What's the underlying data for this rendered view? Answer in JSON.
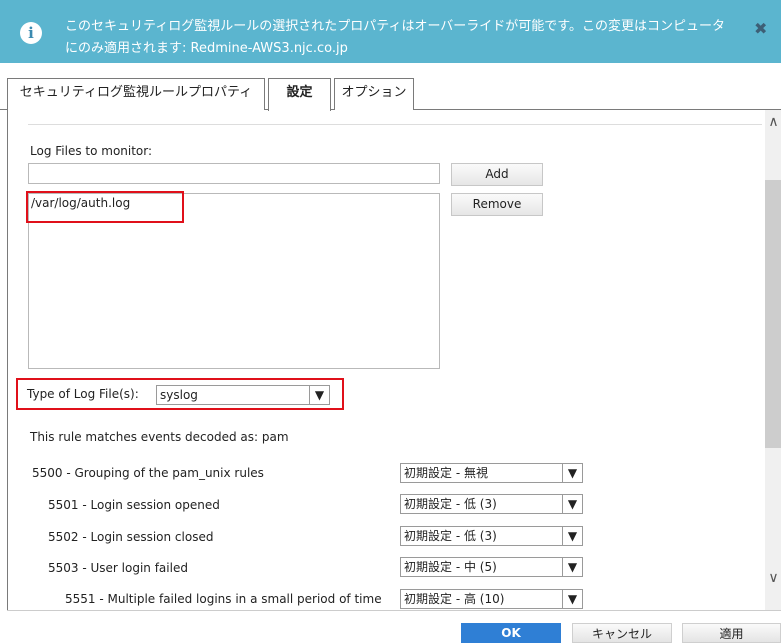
{
  "banner": {
    "icon": "info-icon",
    "line1": "このセキュリティログ監視ルールの選択されたプロパティはオーバーライドが可能です。この変更はコンピュータ",
    "line2": "にのみ適用されます: Redmine-AWS3.njc.co.jp",
    "close_glyph": "✖",
    "color": "#5bb5cf"
  },
  "tabs": [
    {
      "label": "セキュリティログ監視ルールプロパティ",
      "active": false
    },
    {
      "label": "設定",
      "active": true
    },
    {
      "label": "オプション",
      "active": false
    }
  ],
  "log_files": {
    "label": "Log Files to monitor:",
    "input_value": "",
    "add_label": "Add",
    "remove_label": "Remove",
    "items": [
      "/var/log/auth.log"
    ]
  },
  "type_of_log": {
    "label": "Type of Log File(s):",
    "selected": "syslog"
  },
  "decoded_text": "This rule matches events decoded as: pam",
  "rules": [
    {
      "label": "5500 - Grouping of the pam_unix rules",
      "severity": "初期設定 - 無視"
    },
    {
      "label": "5501 - Login session opened",
      "severity": "初期設定 - 低 (3)"
    },
    {
      "label": "5502 - Login session closed",
      "severity": "初期設定 - 低 (3)"
    },
    {
      "label": "5503 - User login failed",
      "severity": "初期設定 - 中 (5)"
    },
    {
      "label": "5551 - Multiple failed logins in a small period of time",
      "severity": "初期設定 - 高 (10)"
    }
  ],
  "footer": {
    "ok": "OK",
    "cancel": "キャンセル",
    "apply": "適用"
  },
  "colors": {
    "highlight": "#e0101a",
    "primary_button": "#2f7fd5"
  }
}
